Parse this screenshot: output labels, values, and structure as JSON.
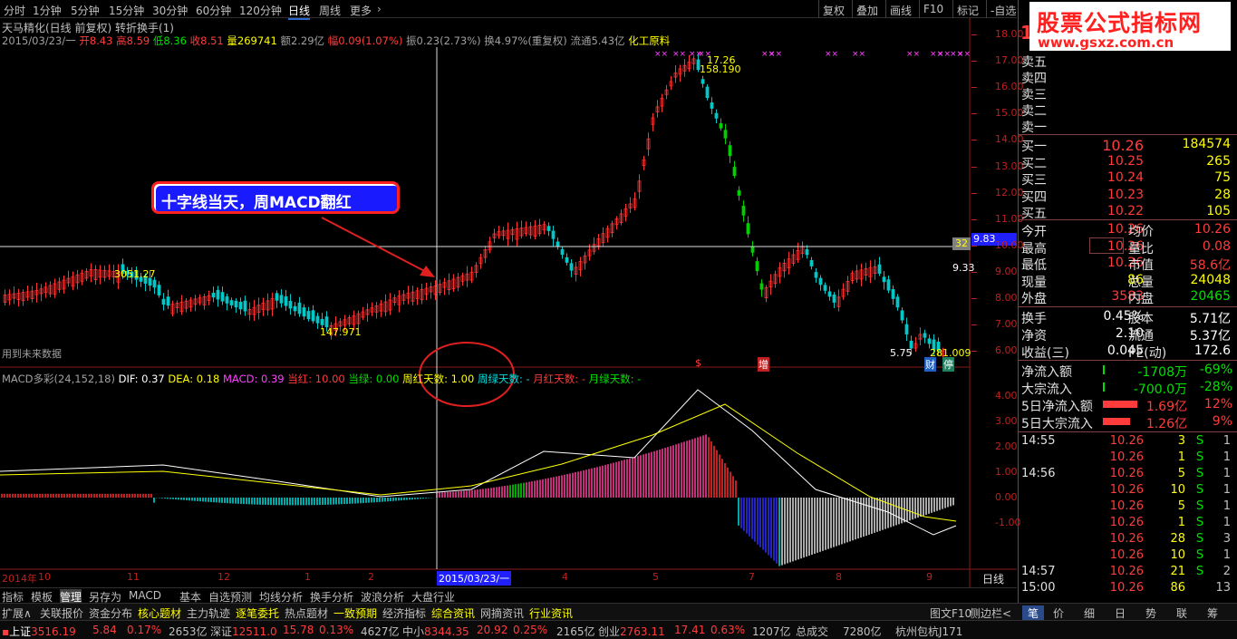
{
  "topbar": {
    "periods": [
      "分时",
      "1分钟",
      "5分钟",
      "15分钟",
      "30分钟",
      "60分钟",
      "120分钟",
      "日线",
      "周线",
      "更多"
    ],
    "active": "日线",
    "right_buttons": [
      "复权",
      "叠加",
      "画线",
      "F10",
      "标记",
      "-自选"
    ]
  },
  "title": "天马精化(日线 前复权) 转折换手(1)",
  "quote_line": {
    "date": "2015/03/23/一",
    "open": "开8.43",
    "high": "高8.59",
    "low": "低8.36",
    "close": "收8.51",
    "vol": "量269741",
    "amount": "额2.29亿",
    "change": "幅0.09(1.07%)",
    "amp": "振0.23(2.73%)",
    "turnover": "换4.97%(重复权)",
    "float": "流通5.43亿",
    "sector": "化工原料"
  },
  "price_labels": {
    "peak": "17.26",
    "peak2": "158.190",
    "low1": "147.971",
    "left": "3051.27",
    "right1": "5.75",
    "right2": "281.009",
    "cross": "9.83",
    "last": "9.33",
    "badge": "32"
  },
  "y_axis": [
    "18.00",
    "17.00",
    "16.00",
    "15.00",
    "14.00",
    "13.00",
    "12.00",
    "11.00",
    "10.00",
    "9.00",
    "8.00",
    "7.00",
    "6.00"
  ],
  "future_note": "用到未来数据",
  "events": {
    "e1": "$",
    "e2": "增",
    "e3": "财",
    "e4": "停"
  },
  "callout": "十字线当天，周MACD翻红",
  "macd_line": {
    "name": "MACD多彩(24,152,18)",
    "dif": "DIF: 0.37",
    "dea": "DEA: 0.18",
    "macd": "MACD: 0.39",
    "dang_hong": "当红: 10.00",
    "dang_lv": "当绿: 0.00",
    "zhou_hong": "周红天数: 1.00",
    "zhou_lv": "周绿天数: -",
    "yue_hong": "月红天数: -",
    "yue_lv": "月绿天数: -"
  },
  "macd_axis": [
    "4.00",
    "3.00",
    "2.00",
    "1.00",
    "0.00",
    "-1.00"
  ],
  "x_axis": {
    "labels": [
      "2014年",
      "10",
      "11",
      "12",
      "1",
      "2",
      "3",
      "4",
      "5",
      "6",
      "7",
      "8",
      "9"
    ],
    "cursor": "2015/03/23/一",
    "period": "日线"
  },
  "bottom_tabs": [
    "指标",
    "模板",
    "管理",
    "另存为",
    "MACD",
    "基本",
    "自选预测",
    "均线分析",
    "换手分析",
    "波浪分析",
    "大盘行业"
  ],
  "tabs2": [
    "扩展∧",
    "关联报价",
    "资金分布",
    "核心题材",
    "主力轨迹",
    "逐笔委托",
    "热点题材",
    "一致预期",
    "经济指标",
    "综合资讯",
    "网摘资讯",
    "行业资讯"
  ],
  "tabs2_right": [
    "图文F10",
    "侧边栏<"
  ],
  "right_tabs": [
    "笔",
    "价",
    "细",
    "日",
    "势",
    "联",
    "筹"
  ],
  "logo": "股票公式指标网",
  "logo_url": "www.gsxz.com.cn",
  "big_digit": "1",
  "order_book": {
    "sell": [
      "卖五",
      "卖四",
      "卖三",
      "卖二",
      "卖一"
    ],
    "buy": [
      [
        "买一",
        "10.26",
        "184574"
      ],
      [
        "买二",
        "10.25",
        "265"
      ],
      [
        "买三",
        "10.24",
        "75"
      ],
      [
        "买四",
        "10.23",
        "28"
      ],
      [
        "买五",
        "10.22",
        "105"
      ]
    ]
  },
  "stats": [
    [
      "今开",
      "10.26",
      "均价",
      "10.26"
    ],
    [
      "最高",
      "10.26",
      "量比",
      "0.08"
    ],
    [
      "最低",
      "10.26",
      "市值",
      "58.6亿"
    ],
    [
      "现量",
      "86",
      "总量",
      "24048"
    ],
    [
      "外盘",
      "3583",
      "内盘",
      "20465"
    ]
  ],
  "stats2": [
    [
      "换手",
      "0.45%",
      "股本",
      "5.71亿"
    ],
    [
      "净资",
      "2.10",
      "流通",
      "5.37亿"
    ],
    [
      "收益(三)",
      "0.045",
      "PE(动)",
      "172.6"
    ]
  ],
  "flows": [
    [
      "净流入额",
      "-1708万",
      "-69%"
    ],
    [
      "大宗流入",
      "-700.0万",
      "-28%"
    ],
    [
      "5日净流入额",
      "1.69亿",
      "12%"
    ],
    [
      "5日大宗流入",
      "1.26亿",
      "9%"
    ]
  ],
  "ticks": [
    [
      "14:55",
      "10.26",
      "3",
      "S",
      "1"
    ],
    [
      "",
      "10.26",
      "1",
      "S",
      "1"
    ],
    [
      "14:56",
      "10.26",
      "5",
      "S",
      "1"
    ],
    [
      "",
      "10.26",
      "10",
      "S",
      "1"
    ],
    [
      "",
      "10.26",
      "5",
      "S",
      "1"
    ],
    [
      "",
      "10.26",
      "1",
      "S",
      "1"
    ],
    [
      "",
      "10.26",
      "28",
      "S",
      "3"
    ],
    [
      "",
      "10.26",
      "10",
      "S",
      "1"
    ],
    [
      "14:57",
      "10.26",
      "21",
      "S",
      "2"
    ],
    [
      "15:00",
      "10.26",
      "86",
      "",
      "13"
    ]
  ],
  "status": {
    "sh": "上证",
    "sh_v": "3516.19",
    "sh_c": "5.84",
    "sh_p": "0.17%",
    "sh_a": "2653亿",
    "sz": "深证",
    "sz_v": "12511.0",
    "sz_c": "15.78",
    "sz_p": "0.13%",
    "sz_a": "4627亿",
    "zx": "中小",
    "zx_v": "8344.35",
    "zx_c": "20.92",
    "zx_p": "0.25%",
    "zx_a": "2165亿",
    "cy": "创业",
    "cy_v": "2763.11",
    "cy_c": "17.41",
    "cy_p": "0.63%",
    "cy_a": "1207亿",
    "total": "总成交",
    "total_v": "7280亿",
    "loc": "杭州包杭J171"
  }
}
